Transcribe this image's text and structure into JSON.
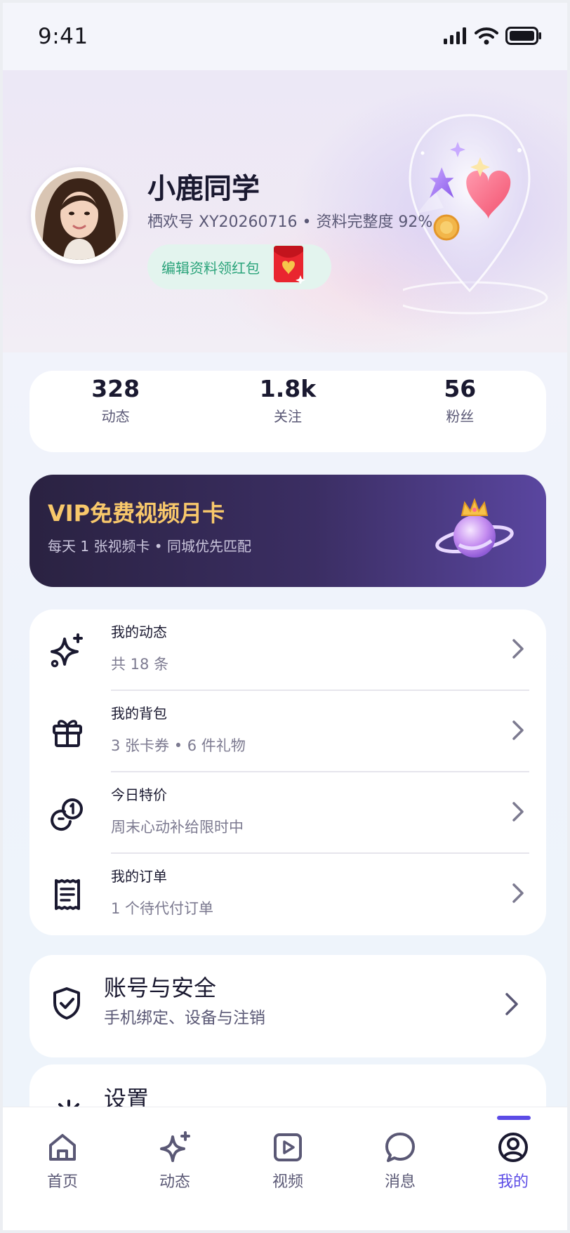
{
  "status_bar": {
    "time": "9:41"
  },
  "profile": {
    "name": "小鹿同学",
    "id_line": "栖欢号 XY20260716 • 资料完整度 92%",
    "edit_button": "编辑资料领红包"
  },
  "stats": [
    {
      "value": "328",
      "label": "动态"
    },
    {
      "value": "1.8k",
      "label": "关注"
    },
    {
      "value": "56",
      "label": "粉丝"
    }
  ],
  "vip": {
    "title": "VIP免费视频月卡",
    "subtitle": "每天 1 张视频卡 • 同城优先匹配"
  },
  "menu": [
    {
      "title": "我的动态",
      "subtitle": "共 18 条",
      "icon": "sparkle-icon"
    },
    {
      "title": "我的背包",
      "subtitle": "3 张卡券 • 6 件礼物",
      "icon": "gift-icon"
    },
    {
      "title": "今日特价",
      "subtitle": "周末心动补给限时中",
      "icon": "coins-icon"
    },
    {
      "title": "我的订单",
      "subtitle": "1 个待代付订单",
      "icon": "receipt-icon"
    }
  ],
  "account": {
    "title": "账号与安全",
    "subtitle": "手机绑定、设备与注销"
  },
  "settings": {
    "title": "设置"
  },
  "tabbar": [
    {
      "label": "首页",
      "icon": "home-icon"
    },
    {
      "label": "动态",
      "icon": "sparkle-icon"
    },
    {
      "label": "视频",
      "icon": "video-icon"
    },
    {
      "label": "消息",
      "icon": "chat-icon"
    },
    {
      "label": "我的",
      "icon": "profile-icon",
      "active": true
    }
  ],
  "colors": {
    "accent": "#5b4be6",
    "vip_gold": "#f8c86b",
    "edit_green": "#2aa37a"
  }
}
